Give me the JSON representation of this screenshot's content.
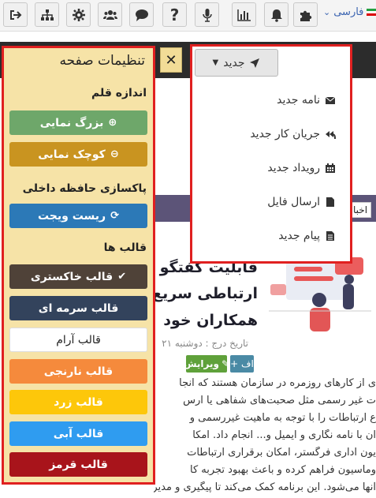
{
  "toolbar": {
    "language": "فارسی",
    "icons": [
      "logout-icon",
      "org-chart-icon",
      "settings-icon",
      "users-icon",
      "comment-icon",
      "help-icon",
      "microphone-icon",
      "bar-chart-icon",
      "bell-icon",
      "puzzle-icon"
    ]
  },
  "settings_panel": {
    "title": "تنظیمات صفحه",
    "font_size_title": "اندازه قلم",
    "zoom_in": "بزرگ نمایی",
    "zoom_out": "کوچک نمایی",
    "cache_title": "پاکسازی حافظه داخلی",
    "reset_widget": "ریست ویجت",
    "themes_title": "قالب ها",
    "themes": [
      {
        "label": "قالب خاکستری",
        "color": "#4f4238",
        "text_color": "#ffffff"
      },
      {
        "label": "قالب سرمه ای",
        "color": "#33435c",
        "text_color": "#ffffff"
      },
      {
        "label": "قالب آرام",
        "color": "#ffffff",
        "text_color": "#222222"
      },
      {
        "label": "قالب نارنجی",
        "color": "#f58a3c",
        "text_color": "#ffffff"
      },
      {
        "label": "قالب زرد",
        "color": "#fdc70a",
        "text_color": "#ffffff"
      },
      {
        "label": "قالب آبی",
        "color": "#2f9cf0",
        "text_color": "#ffffff"
      },
      {
        "label": "قالب قرمز",
        "color": "#a8141b",
        "text_color": "#ffffff"
      }
    ],
    "button_colors": {
      "zoom_in": "#6ea76a",
      "zoom_out": "#c99420",
      "reset": "#2c79b7"
    }
  },
  "new_menu": {
    "button_label": "جدید",
    "items": [
      {
        "label": "نامه جدید",
        "icon": "envelope-icon"
      },
      {
        "label": "جریان کار جدید",
        "icon": "reply-all-icon"
      },
      {
        "label": "رویداد جدید",
        "icon": "calendar-icon"
      },
      {
        "label": "ارسال فایل",
        "icon": "file-icon"
      },
      {
        "label": "پیام جدید",
        "icon": "document-icon"
      }
    ]
  },
  "article": {
    "news_label": "اخبا",
    "headline_lines": [
      "قابلیت گفتگو",
      "ارتباطی سریع",
      "همکاران خود"
    ],
    "date_line": "تاریخ درج : دوشنبه ۲۱",
    "edit_label": "ویرایش",
    "add_label": "+ اف",
    "body_lines": [
      "ی از کارهای روزمره در سازمان هستند که انجا",
      "ت غیر رسمی مثل صحبت‌های شفاهی یا ارس",
      "ع ارتباطات را با توجه به ماهیت غیررسمی و",
      "ان با نامه نگاری و ایمیل و... انجام داد. امکا",
      "یون اداری فرگستر، امکان برقراری ارتباطات",
      "وماسیون فراهم کرده و باعث بهبود تجربه کا",
      "آنها می‌شود. این برنامه کمک می‌کند تا پیگیری و مدیریت امور"
    ]
  }
}
